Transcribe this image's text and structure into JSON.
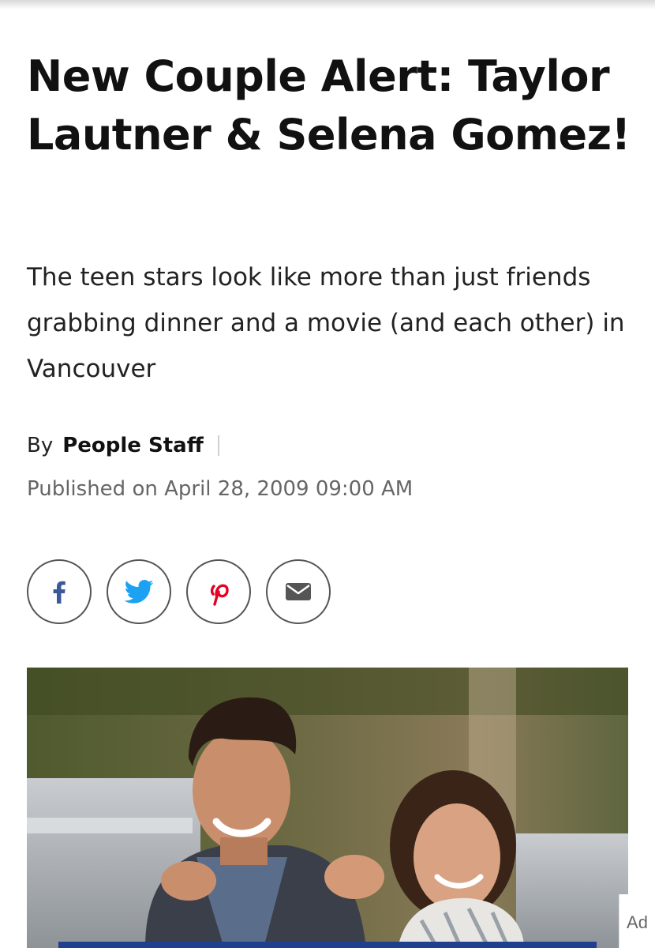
{
  "article": {
    "headline": "New Couple Alert: Taylor Lautner & Selena Gomez!",
    "dek": "The teen stars look like more than just friends grabbing dinner and a movie (and each other) in Vancouver",
    "byline_prefix": "By",
    "author": "People Staff",
    "published": "Published on April 28, 2009 09:00 AM"
  },
  "share": {
    "buttons": [
      {
        "icon": "facebook-icon",
        "color": "#3b5998"
      },
      {
        "icon": "twitter-icon",
        "color": "#1da1f2"
      },
      {
        "icon": "pinterest-icon",
        "color": "#e60023"
      },
      {
        "icon": "email-icon",
        "color": "#555555"
      }
    ]
  },
  "ad": {
    "label": "Ad"
  },
  "colors": {
    "text": "#111111",
    "muted": "#666666",
    "ad_bar": "#1f3f8f"
  }
}
